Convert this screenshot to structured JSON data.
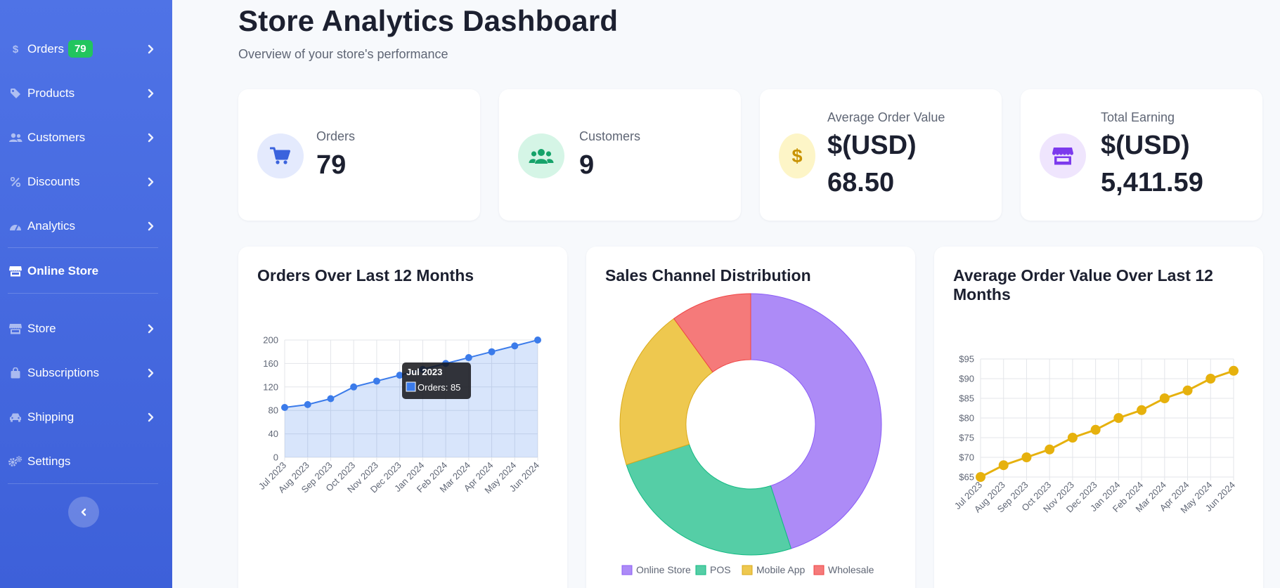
{
  "sidebar": {
    "items": [
      {
        "label": "Orders",
        "icon": "dollar-icon",
        "badge": "79"
      },
      {
        "label": "Products",
        "icon": "tag-icon"
      },
      {
        "label": "Customers",
        "icon": "users-icon"
      },
      {
        "label": "Discounts",
        "icon": "percent-icon"
      },
      {
        "label": "Analytics",
        "icon": "gauge-icon"
      },
      {
        "label": "Online Store",
        "icon": "storefront-icon",
        "active": true
      },
      {
        "label": "Store",
        "icon": "store-icon"
      },
      {
        "label": "Subscriptions",
        "icon": "bag-icon"
      },
      {
        "label": "Shipping",
        "icon": "car-icon"
      },
      {
        "label": "Settings",
        "icon": "gears-icon"
      }
    ]
  },
  "header": {
    "title": "Store Analytics Dashboard",
    "subtitle": "Overview of your store's performance"
  },
  "stats": [
    {
      "label": "Orders",
      "value": "79",
      "icon": "cart-icon",
      "color": "#3b63dd"
    },
    {
      "label": "Customers",
      "value": "9",
      "icon": "users-icon",
      "color": "#16a36a"
    },
    {
      "label": "Average Order Value",
      "value_line1": "$(USD)",
      "value_line2": "68.50",
      "icon": "dollar-icon",
      "color": "#c89200"
    },
    {
      "label": "Total Earning",
      "value_line1": "$(USD)",
      "value_line2": "5,411.59",
      "icon": "storefront-icon",
      "color": "#7c3aed"
    }
  ],
  "colors": {
    "sidebar": "#4468de",
    "accent_blue": "#3b7bea",
    "accent_gold": "#e6b10d"
  },
  "chart_data": [
    {
      "type": "area",
      "title": "Orders Over Last 12 Months",
      "categories": [
        "Jul 2023",
        "Aug 2023",
        "Sep 2023",
        "Oct 2023",
        "Nov 2023",
        "Dec 2023",
        "Jan 2024",
        "Feb 2024",
        "Mar 2024",
        "Apr 2024",
        "May 2024",
        "Jun 2024"
      ],
      "series": [
        {
          "name": "Orders",
          "values": [
            85,
            90,
            100,
            120,
            130,
            140,
            150,
            160,
            170,
            180,
            190,
            200
          ]
        }
      ],
      "ylim": [
        0,
        200
      ],
      "yticks": [
        0,
        40,
        80,
        120,
        160,
        200
      ],
      "grid": true,
      "tooltip": {
        "title": "Jul 2023",
        "text": "Orders: 85"
      }
    },
    {
      "type": "pie",
      "title": "Sales Channel Distribution",
      "categories": [
        "Online Store",
        "POS",
        "Mobile App",
        "Wholesale"
      ],
      "values": [
        45,
        25,
        20,
        10
      ],
      "colors": [
        "#ad8bf7",
        "#55cea6",
        "#eec84f",
        "#f57a7a"
      ],
      "legend": "bottom"
    },
    {
      "type": "line",
      "title": "Average Order Value Over Last 12 Months",
      "categories": [
        "Jul 2023",
        "Aug 2023",
        "Sep 2023",
        "Oct 2023",
        "Nov 2023",
        "Dec 2023",
        "Jan 2024",
        "Feb 2024",
        "Mar 2024",
        "Apr 2024",
        "May 2024",
        "Jun 2024"
      ],
      "series": [
        {
          "name": "Average Order Value",
          "values": [
            65,
            68,
            70,
            72,
            75,
            77,
            80,
            82,
            85,
            87,
            90,
            92
          ]
        }
      ],
      "ylim": [
        65,
        95
      ],
      "yticks": [
        65,
        70,
        75,
        80,
        85,
        90,
        95
      ],
      "ytick_labels": [
        "$65",
        "$70",
        "$75",
        "$80",
        "$85",
        "$90",
        "$95"
      ],
      "grid": true
    }
  ]
}
